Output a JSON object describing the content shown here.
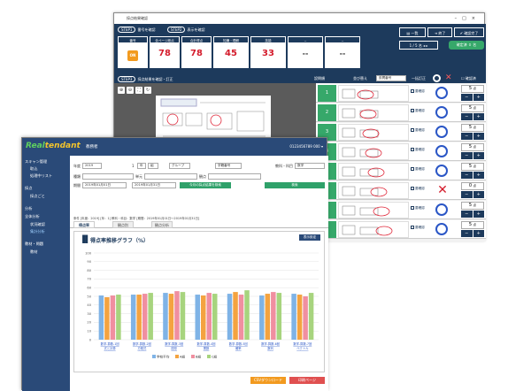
{
  "back_window": {
    "title": "採点結果確認",
    "step1": "STEP1",
    "step1_label": "番号を確認",
    "step2": "STEP2",
    "step2_label": "表示を確認",
    "step3": "STEP3",
    "step3_label": "採点結果を確認・訂正",
    "cells": [
      {
        "label": "番号",
        "value": ""
      },
      {
        "label": "全ページ総点",
        "value": "78"
      },
      {
        "label": "合計得点",
        "value": "78"
      },
      {
        "label": "知識・理解",
        "value": "45"
      },
      {
        "label": "技能",
        "value": "33"
      },
      {
        "label": "--",
        "value": "--"
      },
      {
        "label": "--",
        "value": "--"
      }
    ],
    "auto_toggle": "ON",
    "btn_list": "一覧",
    "btn_end": "終了",
    "btn_done": "確認完了",
    "page_nav": "1 / 5 名",
    "next_btn": "確定済 ０ 名",
    "q_label": "設問順",
    "sort_label": "並び替え",
    "sort_value": "設問番号",
    "batch_label": "一括訂正",
    "confirm_label": "確認済",
    "questions": [
      {
        "no": "1",
        "mark": "o",
        "score": "5"
      },
      {
        "no": "2",
        "mark": "o",
        "score": "5"
      },
      {
        "no": "3",
        "mark": "o",
        "score": "5"
      },
      {
        "no": "4",
        "mark": "o",
        "score": "5"
      },
      {
        "no": "5",
        "mark": "o",
        "score": "5"
      },
      {
        "no": "6",
        "mark": "x",
        "score": "0"
      },
      {
        "no": "7",
        "mark": "o",
        "score": "5"
      },
      {
        "no": "8",
        "mark": "o",
        "score": "5"
      }
    ],
    "unit": "点",
    "check_label": "要確認"
  },
  "front_window": {
    "logo_a": "Real",
    "logo_b": "tendant",
    "user": "教務者",
    "user_id": "0123456789 000 ▾",
    "sidebar": [
      {
        "type": "grp",
        "label": "スキャン管理"
      },
      {
        "type": "it",
        "label": "取込"
      },
      {
        "type": "it",
        "label": "処理中リスト"
      },
      {
        "type": "grp",
        "label": "採点"
      },
      {
        "type": "it",
        "label": "採点ごと"
      },
      {
        "type": "grp",
        "label": "分析"
      },
      {
        "type": "grp",
        "label": "全体分析"
      },
      {
        "type": "it",
        "label": "状況確認"
      },
      {
        "type": "it",
        "label": "集計分析"
      },
      {
        "type": "grp",
        "label": "教材・問題"
      },
      {
        "type": "it",
        "label": "教材"
      }
    ],
    "filters": {
      "year_label": "年度",
      "year": "2019",
      "grade_label": "年",
      "grade": "1",
      "class_label": "組",
      "group_label": "グループ",
      "student_label": "学籍番号",
      "subject_label": "教科・科目",
      "subject": "数学",
      "period_label": "期間",
      "date_from": "2019年01月01日",
      "date_to": "2019年01月31日",
      "kind_label": "種類",
      "unit_label": "単元",
      "mode_label": "観点",
      "search_btn": "今月の採点結果を検索",
      "go_btn": "検索"
    },
    "summary": "条件 [年度：2019] [年：1] 教科・科目：数学 [期間：2019年01月01日〜2019年01月31日]",
    "tabs": [
      "得点率",
      "観点別",
      "観点分析"
    ],
    "chart_title": "得点率推移グラフ（%）",
    "chart_btn": "表示設定",
    "export_csv": "CSVダウンロード",
    "print_btn": "印刷ページ"
  },
  "chart_data": {
    "type": "bar",
    "categories": [
      "数学-算数-1回 式と計算",
      "数学-算数-2回 方程式",
      "数学-算数-3回 図形",
      "数学-算数-4回 関数",
      "数学-算数-5回 確率",
      "数学-算数-6回 数列",
      "数学-算数-7回 ベクトル"
    ],
    "series": [
      {
        "name": "学校平均",
        "values": [
          51,
          52,
          54,
          52,
          53,
          51,
          53
        ],
        "color": "#7fb3e6"
      },
      {
        "name": "A組",
        "values": [
          49,
          52,
          53,
          51,
          55,
          53,
          52
        ],
        "color": "#f4a340"
      },
      {
        "name": "B組",
        "values": [
          51,
          53,
          56,
          54,
          52,
          55,
          50
        ],
        "color": "#f08fa0"
      },
      {
        "name": "C組",
        "values": [
          52,
          54,
          55,
          53,
          57,
          54,
          54
        ],
        "color": "#a7d47e"
      }
    ],
    "ylim": [
      0,
      100
    ],
    "yticks": [
      0,
      10,
      20,
      30,
      40,
      50,
      60,
      70,
      80,
      90,
      100
    ]
  }
}
